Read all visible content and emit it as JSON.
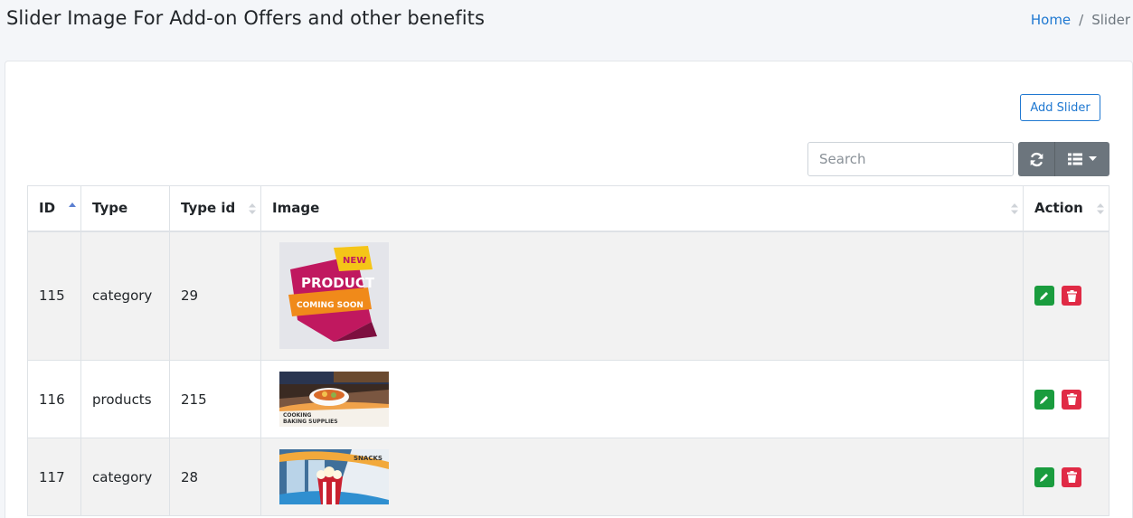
{
  "header": {
    "title": "Slider Image For Add-on Offers and other benefits",
    "breadcrumb_home": "Home",
    "breadcrumb_sep": "/",
    "breadcrumb_current": "Slider"
  },
  "toolbar": {
    "add_label": "Add Slider",
    "search_placeholder": "Search"
  },
  "table": {
    "columns": [
      "ID",
      "Type",
      "Type id",
      "Image",
      "Action"
    ],
    "rows": [
      {
        "id": "115",
        "type": "category",
        "type_id": "29",
        "image": {
          "badge": "NEW",
          "line1": "PRODUCT",
          "line2": "COMING SOON"
        }
      },
      {
        "id": "116",
        "type": "products",
        "type_id": "215",
        "image": {
          "line1": "COOKING",
          "line2": "BAKING SUPPLIES"
        }
      },
      {
        "id": "117",
        "type": "category",
        "type_id": "28",
        "image": {
          "line1": "SNACKS"
        }
      }
    ]
  },
  "colors": {
    "primary": "#1f78d1",
    "secondary": "#6c757d",
    "success": "#1a9c3e",
    "danger": "#e02a45"
  }
}
